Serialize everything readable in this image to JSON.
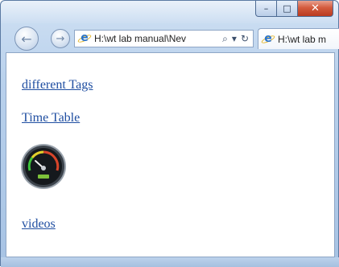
{
  "window": {
    "caption_buttons": {
      "minimize": "–",
      "maximize": "□",
      "close": "✕"
    }
  },
  "nav": {
    "back_icon": "←",
    "forward_icon": "→",
    "address": "H:\\wt lab manual\\Nev",
    "search_icon": "⌕",
    "dropdown_icon": "▾",
    "refresh_icon": "↻",
    "tab_label": "H:\\wt lab m"
  },
  "page": {
    "links": [
      {
        "label": "different Tags"
      },
      {
        "label": "Time Table"
      },
      {
        "label": "videos"
      }
    ],
    "image": {
      "icon": "speedometer-icon"
    }
  },
  "colors": {
    "link": "#1f4ea1",
    "chrome": "#b9d1ec",
    "close_button": "#d35b3e"
  }
}
